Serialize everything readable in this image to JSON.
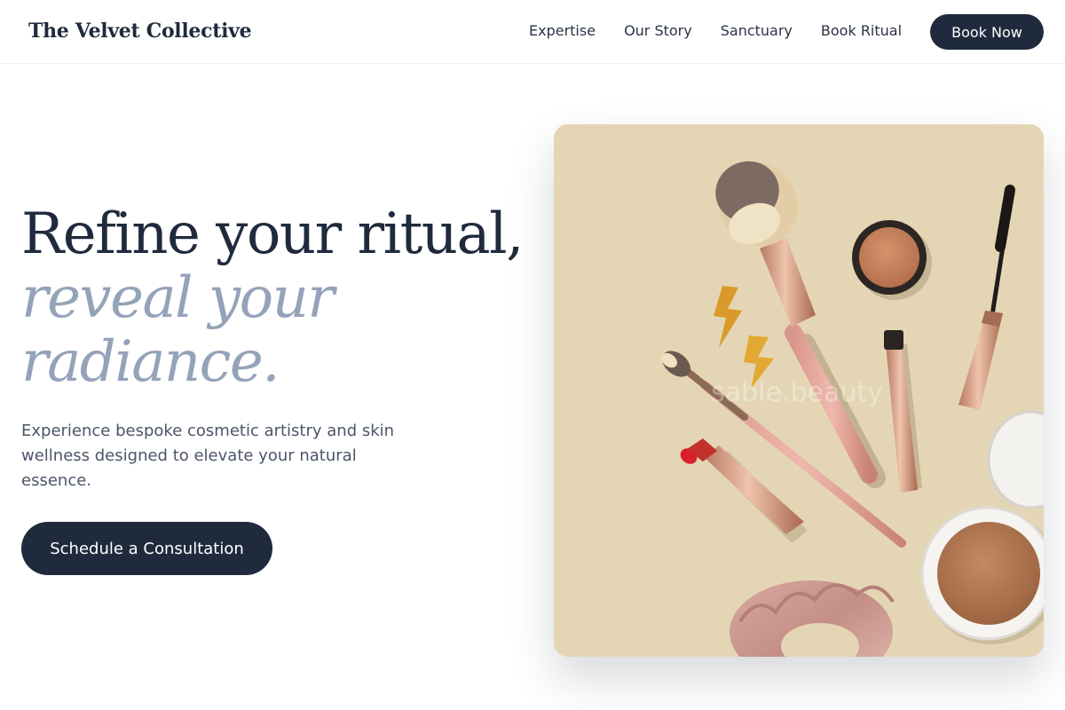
{
  "brand": {
    "name": "The Velvet Collective"
  },
  "nav": {
    "links": [
      "Expertise",
      "Our Story",
      "Sanctuary",
      "Book Ritual"
    ],
    "cta_label": "Book Now"
  },
  "hero": {
    "title_line1": "Refine your ritual,",
    "title_line2": "reveal your radiance.",
    "subtitle": "Experience bespoke cosmetic artistry and skin wellness designed to elevate your natural essence.",
    "cta_label": "Schedule a Consultation",
    "image": {
      "subject": "flat-lay cosmetics: brushes, lipstick, mascara, compact powder, velvet scrunchie, lightning earrings",
      "watermark": "sable.beauty"
    }
  },
  "colors": {
    "primary": "#1f2a3d",
    "accent_muted": "#94a3b8",
    "image_background": "#e4d6b4"
  }
}
